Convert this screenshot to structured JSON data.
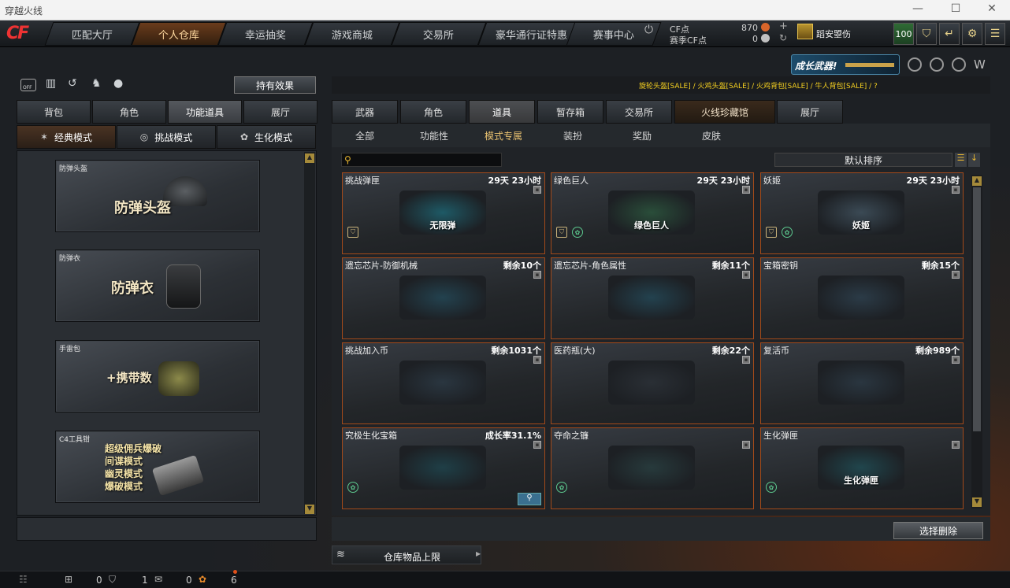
{
  "window": {
    "title": "穿越火线",
    "min": "—",
    "max": "☐",
    "close": "✕"
  },
  "logo": "CF",
  "nav": {
    "tabs": [
      "匹配大厅",
      "个人仓库",
      "幸运抽奖",
      "游戏商城",
      "交易所",
      "豪华通行证特惠",
      "赛事中心"
    ],
    "active": 1,
    "power": "⏻"
  },
  "currency": {
    "cf_label": "CF点",
    "cf_value": "870",
    "event_label": "赛季CF点",
    "event_value": "0",
    "plus": "+",
    "refresh": "↻"
  },
  "user": {
    "name": "蹈安曌伤",
    "level": "100"
  },
  "banner": {
    "text": "成长武器!"
  },
  "left": {
    "effect_button": "持有效果",
    "off_label": "OFF",
    "tabs": [
      "背包",
      "角色",
      "功能道具",
      "展厅"
    ],
    "active_tab": 2,
    "modes": [
      {
        "icon": "✶",
        "label": "经典模式"
      },
      {
        "icon": "◎",
        "label": "挑战模式"
      },
      {
        "icon": "✿",
        "label": "生化模式"
      }
    ],
    "active_mode": 0,
    "cards": [
      {
        "label": "防弹头盔",
        "big": "防弹头盔"
      },
      {
        "label": "防弹衣",
        "big": "防弹衣"
      },
      {
        "label": "手雷包",
        "big": "+携带数"
      },
      {
        "label": "C4工具钳",
        "lines": [
          "超级佣兵爆破",
          "间谍模式",
          "幽灵模式",
          "爆破模式"
        ]
      }
    ]
  },
  "right": {
    "ticker": "旋轮头盔[SALE] / 火鸡头盔[SALE] / 火鸡背包[SALE] / 牛人背包[SALE] / ?",
    "tabs": [
      "武器",
      "角色",
      "道具",
      "暂存箱",
      "交易所",
      "火线珍藏馆",
      "展厅"
    ],
    "active_tab": 2,
    "subtabs": [
      "全部",
      "功能性",
      "模式专属",
      "装扮",
      "奖励",
      "皮肤"
    ],
    "active_subtab": 2,
    "search_placeholder": "",
    "sort": "默认排序",
    "items": [
      {
        "name": "挑战弹匣",
        "count": "29天 23小时",
        "img_text": "无限弹",
        "tags": [
          "s"
        ]
      },
      {
        "name": "绿色巨人",
        "count": "29天 23小时",
        "img_text": "绿色巨人",
        "tags": [
          "s",
          "g"
        ]
      },
      {
        "name": "妖姬",
        "count": "29天 23小时",
        "img_text": "妖姬",
        "tags": [
          "s",
          "g"
        ]
      },
      {
        "name": "遗忘芯片-防御机械",
        "count": "剩余10个",
        "img_text": "",
        "tags": []
      },
      {
        "name": "遗忘芯片-角色属性",
        "count": "剩余11个",
        "img_text": "",
        "tags": []
      },
      {
        "name": "宝箱密钥",
        "count": "剩余15个",
        "img_text": "",
        "tags": []
      },
      {
        "name": "挑战加入币",
        "count": "剩余1031个",
        "img_text": "",
        "tags": []
      },
      {
        "name": "医药瓶(大)",
        "count": "剩余22个",
        "img_text": "",
        "tags": []
      },
      {
        "name": "复活币",
        "count": "剩余989个",
        "img_text": "",
        "tags": []
      },
      {
        "name": "究极生化宝箱",
        "count": "成长率31.1%",
        "img_text": "",
        "tags": [
          "g"
        ]
      },
      {
        "name": "夺命之镰",
        "count": "",
        "img_text": "",
        "tags": [
          "g"
        ]
      },
      {
        "name": "生化弹匣",
        "count": "",
        "img_text": "生化弹匣",
        "tags": [
          "g"
        ]
      }
    ],
    "select_delete": "选择删除",
    "capacity": "仓库物品上限"
  },
  "status": {
    "v1": "0",
    "v2": "1",
    "v3": "0",
    "v4": "6"
  }
}
